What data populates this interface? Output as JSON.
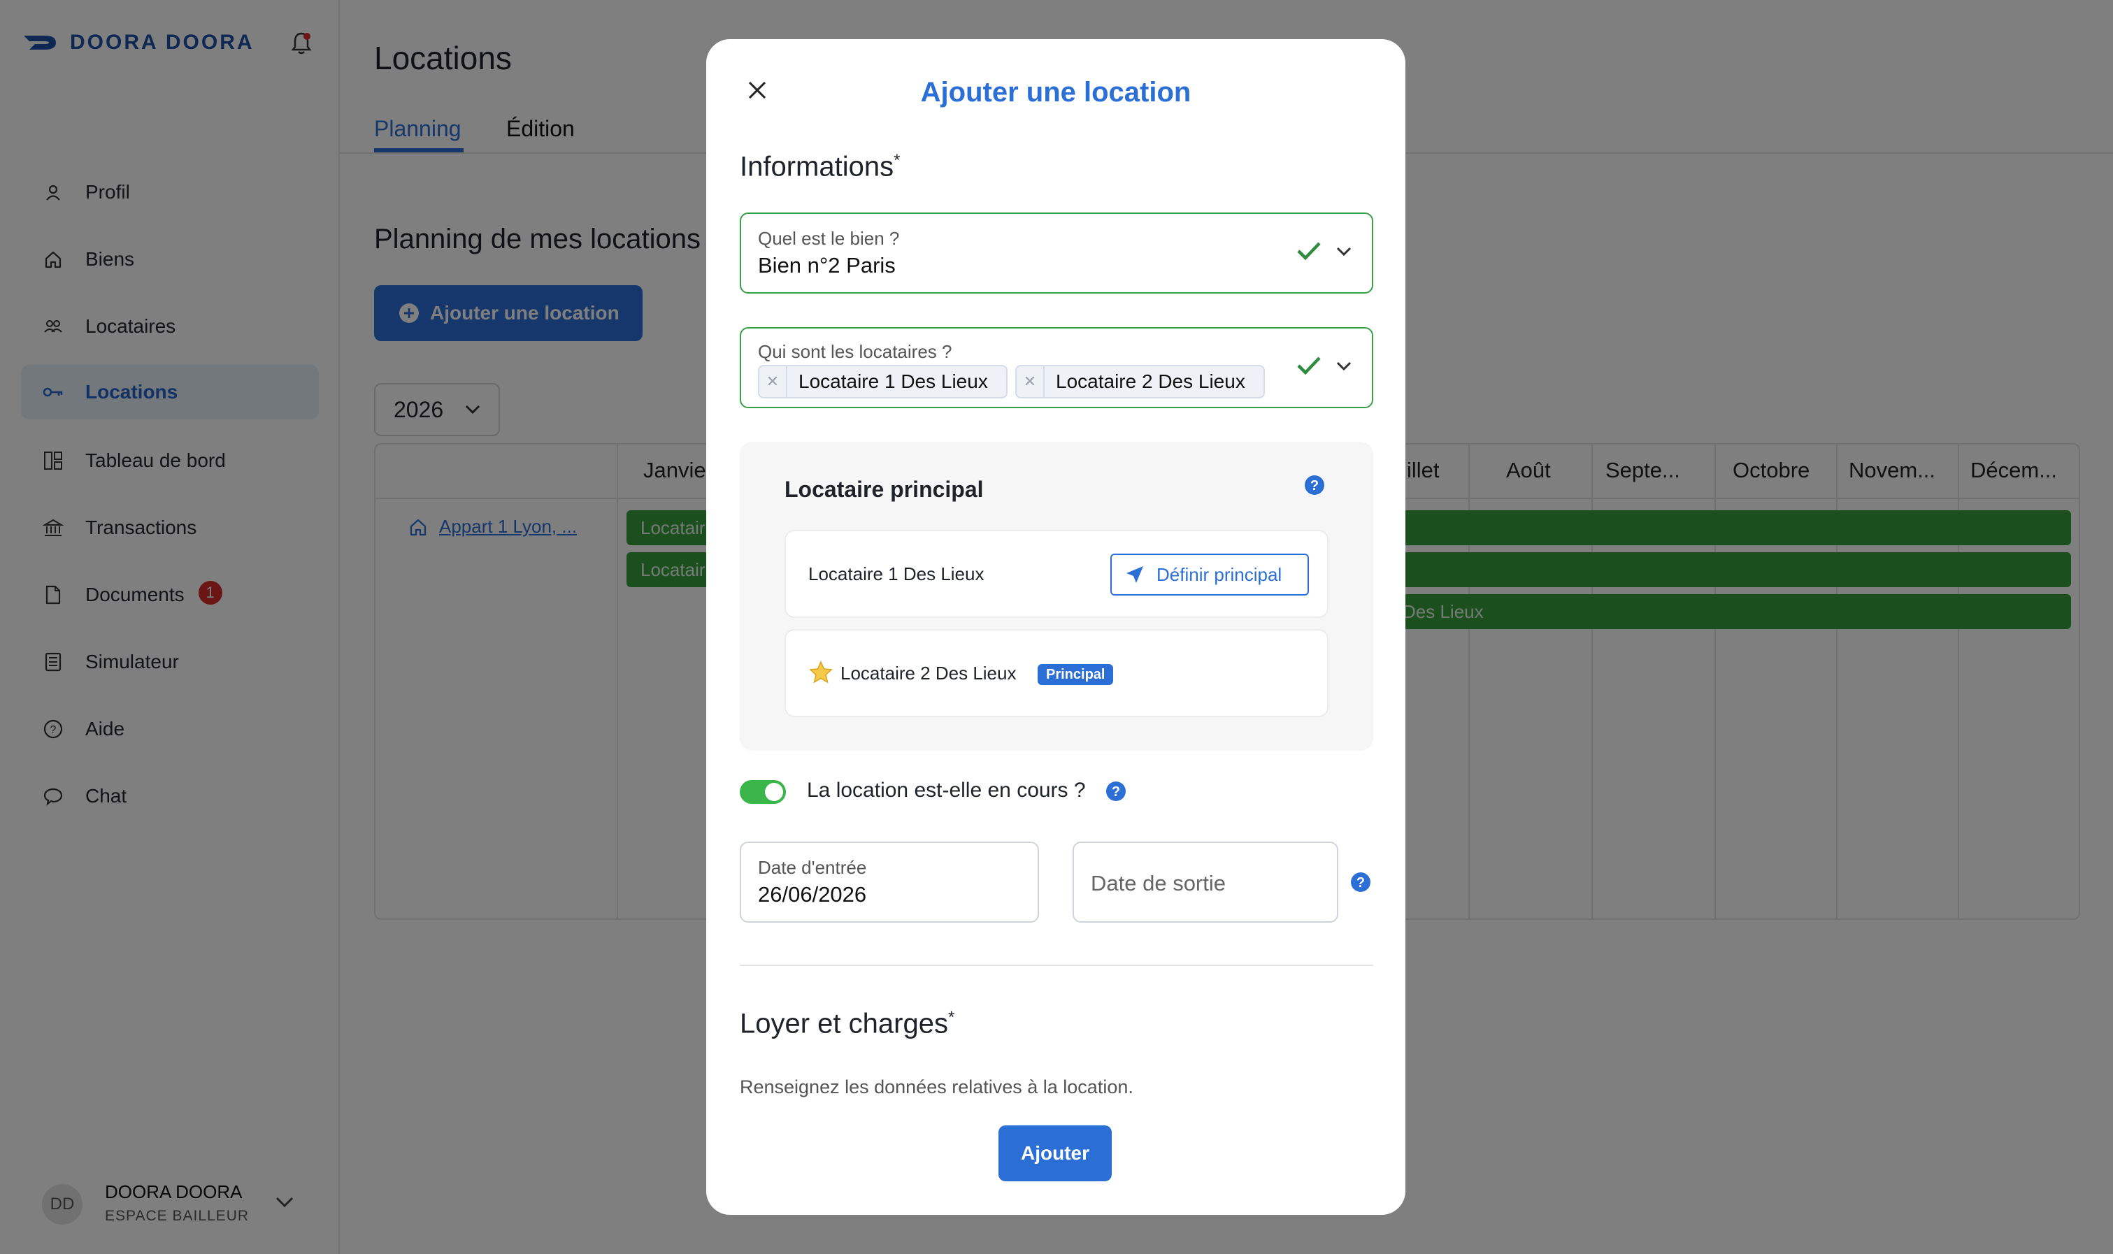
{
  "brand": {
    "name": "DOORA DOORA"
  },
  "sidebar": {
    "items": [
      {
        "label": "Profil",
        "icon": "user-icon"
      },
      {
        "label": "Biens",
        "icon": "home-icon"
      },
      {
        "label": "Locataires",
        "icon": "users-icon"
      },
      {
        "label": "Locations",
        "icon": "key-icon"
      },
      {
        "label": "Tableau de bord",
        "icon": "dashboard-icon"
      },
      {
        "label": "Transactions",
        "icon": "bank-icon"
      },
      {
        "label": "Documents",
        "icon": "document-icon",
        "badge": "1"
      },
      {
        "label": "Simulateur",
        "icon": "calculator-icon"
      },
      {
        "label": "Aide",
        "icon": "help-icon"
      },
      {
        "label": "Chat",
        "icon": "chat-icon"
      }
    ],
    "user": {
      "initials": "DD",
      "name": "DOORA DOORA",
      "role": "ESPACE BAILLEUR"
    }
  },
  "main": {
    "title": "Locations",
    "tabs": [
      "Planning",
      "Édition"
    ],
    "section_title": "Planning de mes locations",
    "add_button": "Ajouter une location",
    "year": "2026",
    "months_visible": [
      "Janvie",
      "illet",
      "Août",
      "Septe...",
      "Octobre",
      "Novem...",
      "Décem..."
    ],
    "property_link": "Appart 1 Lyon, ...",
    "bars": [
      "Locatair",
      "Locatair",
      "Des Lieux"
    ]
  },
  "modal": {
    "title": "Ajouter une location",
    "informations_heading": "Informations",
    "required_mark": "*",
    "bien": {
      "label": "Quel est le bien ?",
      "value": "Bien n°2 Paris"
    },
    "locataires": {
      "label": "Qui sont les locataires ?",
      "chips": [
        "Locataire 1 Des Lieux",
        "Locataire 2 Des Lieux"
      ]
    },
    "principal": {
      "heading": "Locataire principal",
      "rows": [
        {
          "name": "Locataire 1 Des Lieux",
          "action": "Définir principal"
        },
        {
          "name": "Locataire 2 Des Lieux",
          "badge": "Principal"
        }
      ]
    },
    "en_cours": {
      "label": "La location est-elle en cours ?",
      "on": true
    },
    "date_entree": {
      "label": "Date d'entrée",
      "value": "26/06/2026"
    },
    "date_sortie": {
      "placeholder": "Date de sortie"
    },
    "loyer_heading": "Loyer et charges",
    "loyer_desc": "Renseignez les données relatives à la location.",
    "submit": "Ajouter"
  },
  "colors": {
    "accent": "#2b6fd6",
    "success": "#38a047",
    "nav_active_bg": "#e7f0fb",
    "bar_green": "#37a13c"
  }
}
